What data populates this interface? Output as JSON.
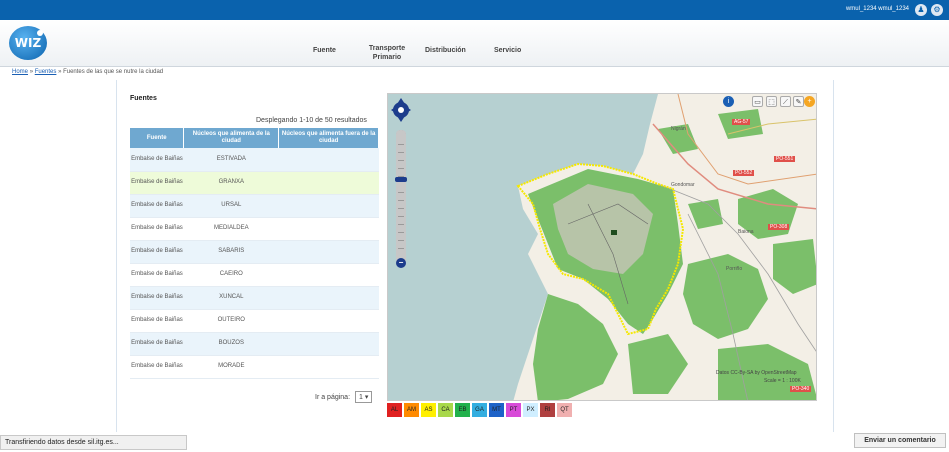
{
  "topbar": {
    "user": "wmul_1234 wmul_1234",
    "icons": [
      "person-icon",
      "gear-icon"
    ]
  },
  "logo": {
    "text": "WIZ"
  },
  "nav": [
    {
      "label": "Fuente"
    },
    {
      "label": "Transporte Primario"
    },
    {
      "label": "Distribución"
    },
    {
      "label": "Servicio"
    }
  ],
  "breadcrumb": {
    "home": "Home",
    "sep": "»",
    "fuentes": "Fuentes",
    "current": "Fuentes de las que se nutre la ciudad"
  },
  "section": {
    "title": "Fuentes",
    "results": "Desplegando 1-10 de 50 resultados"
  },
  "table": {
    "headers": [
      "Fuente",
      "Núcleos que alimenta de la ciudad",
      "Núcleos que alimenta fuera de la ciudad"
    ],
    "rows": [
      {
        "fuente": "Embalse de Baiñas",
        "nucleo": "ESTIVADA",
        "fuera": ""
      },
      {
        "fuente": "Embalse de Baiñas",
        "nucleo": "GRANXA",
        "fuera": ""
      },
      {
        "fuente": "Embalse de Baiñas",
        "nucleo": "URSAL",
        "fuera": ""
      },
      {
        "fuente": "Embalse de Baiñas",
        "nucleo": "MEDIALDEA",
        "fuera": ""
      },
      {
        "fuente": "Embalse de Baiñas",
        "nucleo": "SABARIS",
        "fuera": ""
      },
      {
        "fuente": "Embalse de Baiñas",
        "nucleo": "CAEIRO",
        "fuera": ""
      },
      {
        "fuente": "Embalse de Baiñas",
        "nucleo": "XUNCAL",
        "fuera": ""
      },
      {
        "fuente": "Embalse de Baiñas",
        "nucleo": "OUTEIRO",
        "fuera": ""
      },
      {
        "fuente": "Embalse de Baiñas",
        "nucleo": "BOUZOS",
        "fuera": ""
      },
      {
        "fuente": "Embalse de Baiñas",
        "nucleo": "MORADE",
        "fuera": ""
      }
    ]
  },
  "pager": {
    "label": "Ir a página:",
    "value": "1"
  },
  "map": {
    "attribution": "Datos CC-By-SA by OpenStreetMap",
    "scale": "Scale = 1 : 100K",
    "road_labels": [
      "AG-57",
      "PO-551",
      "PO-552",
      "PO-308",
      "PO-340"
    ],
    "place_labels": [
      "Nigrán",
      "Gondomar",
      "Baiona",
      "Porriño"
    ],
    "colors": {
      "forest": "#7bbf6a",
      "sea": "#b6d0d1",
      "boundary": "#f5e800",
      "land": "#f3efe6"
    }
  },
  "legend": [
    {
      "code": "AL",
      "color": "#e02020"
    },
    {
      "code": "AM",
      "color": "#ff8a00"
    },
    {
      "code": "AS",
      "color": "#ffef00"
    },
    {
      "code": "CA",
      "color": "#a8d84a"
    },
    {
      "code": "EB",
      "color": "#22b14c"
    },
    {
      "code": "GA",
      "color": "#34aee0"
    },
    {
      "code": "MT",
      "color": "#1e62c8"
    },
    {
      "code": "PT",
      "color": "#d84ad8"
    },
    {
      "code": "PX",
      "color": "#cfeeff"
    },
    {
      "code": "RI",
      "color": "#b04040"
    },
    {
      "code": "QT",
      "color": "#f0b0b0"
    }
  ],
  "status": {
    "text": "Transfiriendo datos desde sil.itg.es..."
  },
  "comment_button": {
    "label": "Enviar un comentario"
  }
}
